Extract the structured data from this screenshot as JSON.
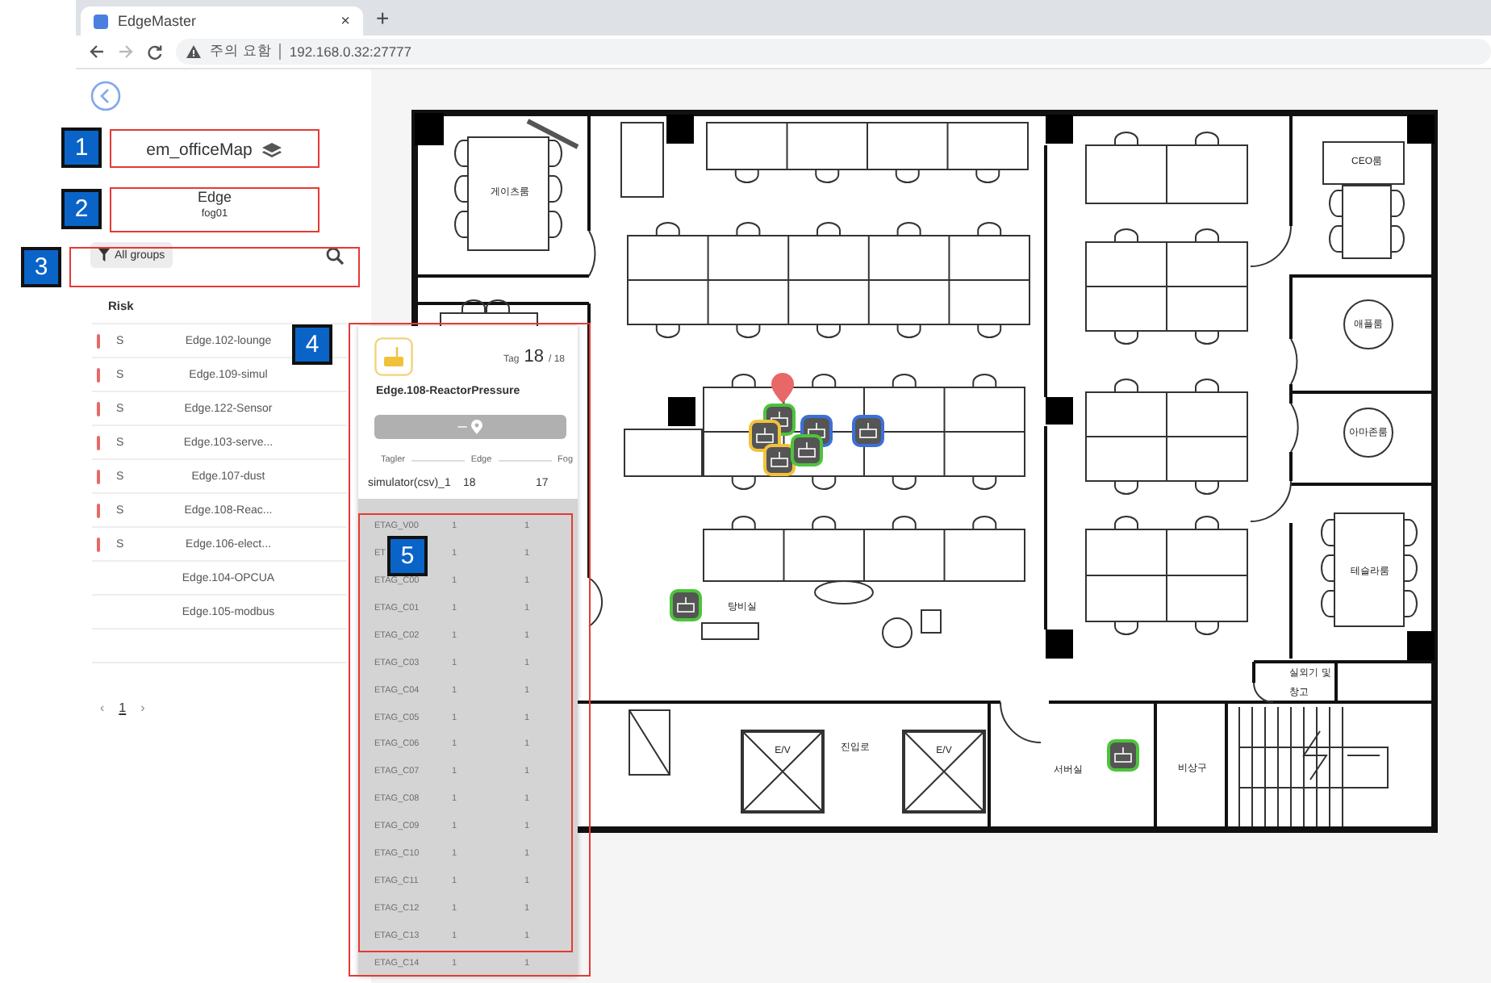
{
  "browser": {
    "tab_title": "EdgeMaster",
    "tab_close": "×",
    "new_tab": "+",
    "security_label": "주의 요함",
    "url": "192.168.0.32:27777"
  },
  "sidebar": {
    "map_name": "em_officeMap",
    "edge_title": "Edge",
    "edge_sub": "fog01",
    "filter": "All groups",
    "risk_header": "Risk",
    "edges": [
      {
        "risk": "S",
        "name": "Edge.102-lounge",
        "alert": true
      },
      {
        "risk": "S",
        "name": "Edge.109-simul",
        "alert": true
      },
      {
        "risk": "S",
        "name": "Edge.122-Sensor",
        "alert": true
      },
      {
        "risk": "S",
        "name": "Edge.103-serve...",
        "alert": true
      },
      {
        "risk": "S",
        "name": "Edge.107-dust",
        "alert": true
      },
      {
        "risk": "S",
        "name": "Edge.108-Reac...",
        "alert": true
      },
      {
        "risk": "S",
        "name": "Edge.106-elect...",
        "alert": true
      },
      {
        "name": "Edge.104-OPCUA",
        "alert": false
      },
      {
        "name": "Edge.105-modbus",
        "alert": false
      }
    ],
    "pagination": {
      "prev": "‹",
      "pages": [
        {
          "label": "1",
          "selected": true
        }
      ],
      "next": "›"
    }
  },
  "map": {
    "rooms": [
      {
        "label": "게이츠룸"
      },
      {
        "label": "CEO룸"
      },
      {
        "label": "애플룸"
      },
      {
        "label": "아마존룸"
      },
      {
        "label": "테슬라룸"
      },
      {
        "label": "탕비실"
      },
      {
        "label": "E/V"
      },
      {
        "label": "진입로"
      },
      {
        "label": "E/V"
      },
      {
        "label": "서버실"
      },
      {
        "label": "비상구"
      },
      {
        "label": "실외기 및"
      },
      {
        "label": "창고"
      }
    ],
    "devices": [
      {
        "color": "#4cc43a"
      },
      {
        "color": "#f0c23c"
      },
      {
        "color": "#f0c23c"
      },
      {
        "color": "#3d6fd6"
      },
      {
        "color": "#4cc43a"
      },
      {
        "color": "#3d6fd6"
      },
      {
        "color": "#4cc43a"
      },
      {
        "color": "#4cc43a"
      }
    ]
  },
  "popup": {
    "tag_label": "Tag",
    "tag_count": "18",
    "tag_total": "/ 18",
    "title": "Edge.108-ReactorPressure",
    "button_label": "–",
    "columns": [
      "Tagler",
      "Edge",
      "Fog"
    ],
    "summary": {
      "name": "simulator(csv)_1",
      "edge": "18",
      "fog": "17"
    },
    "tags": [
      {
        "name": "ETAG_V00",
        "edge": "1",
        "fog": "1"
      },
      {
        "name": "ET",
        "edge": "1",
        "fog": "1"
      },
      {
        "name": "ETAG_C00",
        "edge": "1",
        "fog": "1"
      },
      {
        "name": "ETAG_C01",
        "edge": "1",
        "fog": "1"
      },
      {
        "name": "ETAG_C02",
        "edge": "1",
        "fog": "1"
      },
      {
        "name": "ETAG_C03",
        "edge": "1",
        "fog": "1"
      },
      {
        "name": "ETAG_C04",
        "edge": "1",
        "fog": "1"
      },
      {
        "name": "ETAG_C05",
        "edge": "1",
        "fog": "1"
      },
      {
        "name": "ETAG_C06",
        "edge": "1",
        "fog": "1"
      },
      {
        "name": "ETAG_C07",
        "edge": "1",
        "fog": "1"
      },
      {
        "name": "ETAG_C08",
        "edge": "1",
        "fog": "1"
      },
      {
        "name": "ETAG_C09",
        "edge": "1",
        "fog": "1"
      },
      {
        "name": "ETAG_C10",
        "edge": "1",
        "fog": "1"
      },
      {
        "name": "ETAG_C11",
        "edge": "1",
        "fog": "1"
      },
      {
        "name": "ETAG_C12",
        "edge": "1",
        "fog": "1"
      },
      {
        "name": "ETAG_C13",
        "edge": "1",
        "fog": "1"
      },
      {
        "name": "ETAG_C14",
        "edge": "1",
        "fog": "1"
      }
    ]
  },
  "annotations": [
    {
      "label": "1"
    },
    {
      "label": "2"
    },
    {
      "label": "3"
    },
    {
      "label": "4"
    },
    {
      "label": "5"
    }
  ]
}
